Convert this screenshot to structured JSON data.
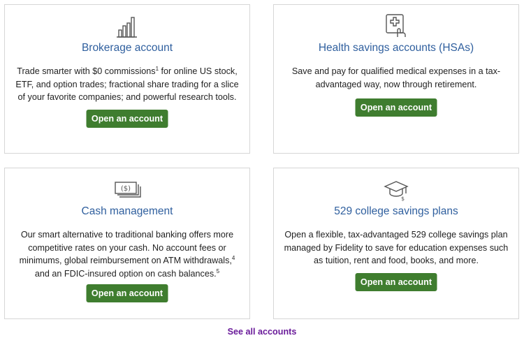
{
  "cards": [
    {
      "icon": "bar-chart-icon",
      "title": "Brokerage account",
      "desc_parts": [
        "Trade smarter with $0 commissions",
        "1",
        " for online US stock, ETF, and option trades; fractional share trading for a slice of your favorite companies; and powerful research tools."
      ],
      "button": "Open an account"
    },
    {
      "icon": "medical-tablet-icon",
      "title": "Health savings accounts (HSAs)",
      "desc_parts": [
        "Save and pay for qualified medical expenses in a tax-advantaged way, now through retirement."
      ],
      "button": "Open an account"
    },
    {
      "icon": "cash-stack-icon",
      "title": "Cash management",
      "desc_parts": [
        "Our smart alternative to traditional banking offers more competitive rates on your cash. No account fees or minimums, global reimbursement on ATM withdrawals,",
        "4",
        " and an FDIC-insured option on cash balances.",
        "5"
      ],
      "button": "Open an account"
    },
    {
      "icon": "graduation-cap-icon",
      "title": "529 college savings plans",
      "desc_parts": [
        "Open a flexible, tax-advantaged 529 college savings plan managed by Fidelity to save for education expenses such as tuition, rent and food, books, and more."
      ],
      "button": "Open an account"
    }
  ],
  "see_all": "See all accounts",
  "colors": {
    "title": "#2f5f9e",
    "button": "#3f7d2f",
    "link": "#6a1b9a",
    "border": "#d6d6d6"
  }
}
